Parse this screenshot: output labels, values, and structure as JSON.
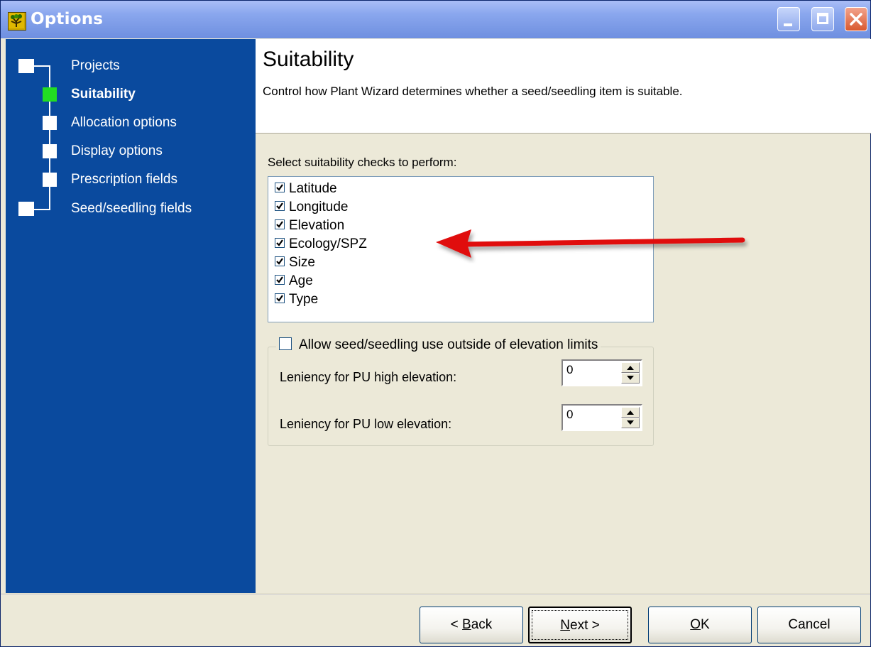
{
  "window": {
    "title": "Options"
  },
  "sidebar": {
    "items": [
      {
        "label": "Projects",
        "active": false
      },
      {
        "label": "Suitability",
        "active": true
      },
      {
        "label": "Allocation options",
        "active": false
      },
      {
        "label": "Display options",
        "active": false
      },
      {
        "label": "Prescription fields",
        "active": false
      },
      {
        "label": "Seed/seedling fields",
        "active": false
      }
    ]
  },
  "header": {
    "title": "Suitability",
    "description": "Control how Plant Wizard determines whether a seed/seedling item is suitable."
  },
  "checks": {
    "label": "Select suitability checks to perform:",
    "items": [
      {
        "label": "Latitude",
        "checked": true
      },
      {
        "label": "Longitude",
        "checked": true
      },
      {
        "label": "Elevation",
        "checked": true
      },
      {
        "label": "Ecology/SPZ",
        "checked": true
      },
      {
        "label": "Size",
        "checked": true
      },
      {
        "label": "Age",
        "checked": true
      },
      {
        "label": "Type",
        "checked": true
      }
    ]
  },
  "elevation": {
    "allow_label": "Allow seed/seedling use outside of elevation limits",
    "allow_checked": false,
    "high_label": "Leniency for PU high elevation:",
    "high_value": "0",
    "low_label": "Leniency for PU low elevation:",
    "low_value": "0"
  },
  "buttons": {
    "back": "Back",
    "next": "Next >",
    "ok": "OK",
    "cancel": "Cancel"
  },
  "colors": {
    "sidebar": "#0a4a9e",
    "active_node": "#22dd22",
    "annotation_arrow": "#e01010"
  }
}
